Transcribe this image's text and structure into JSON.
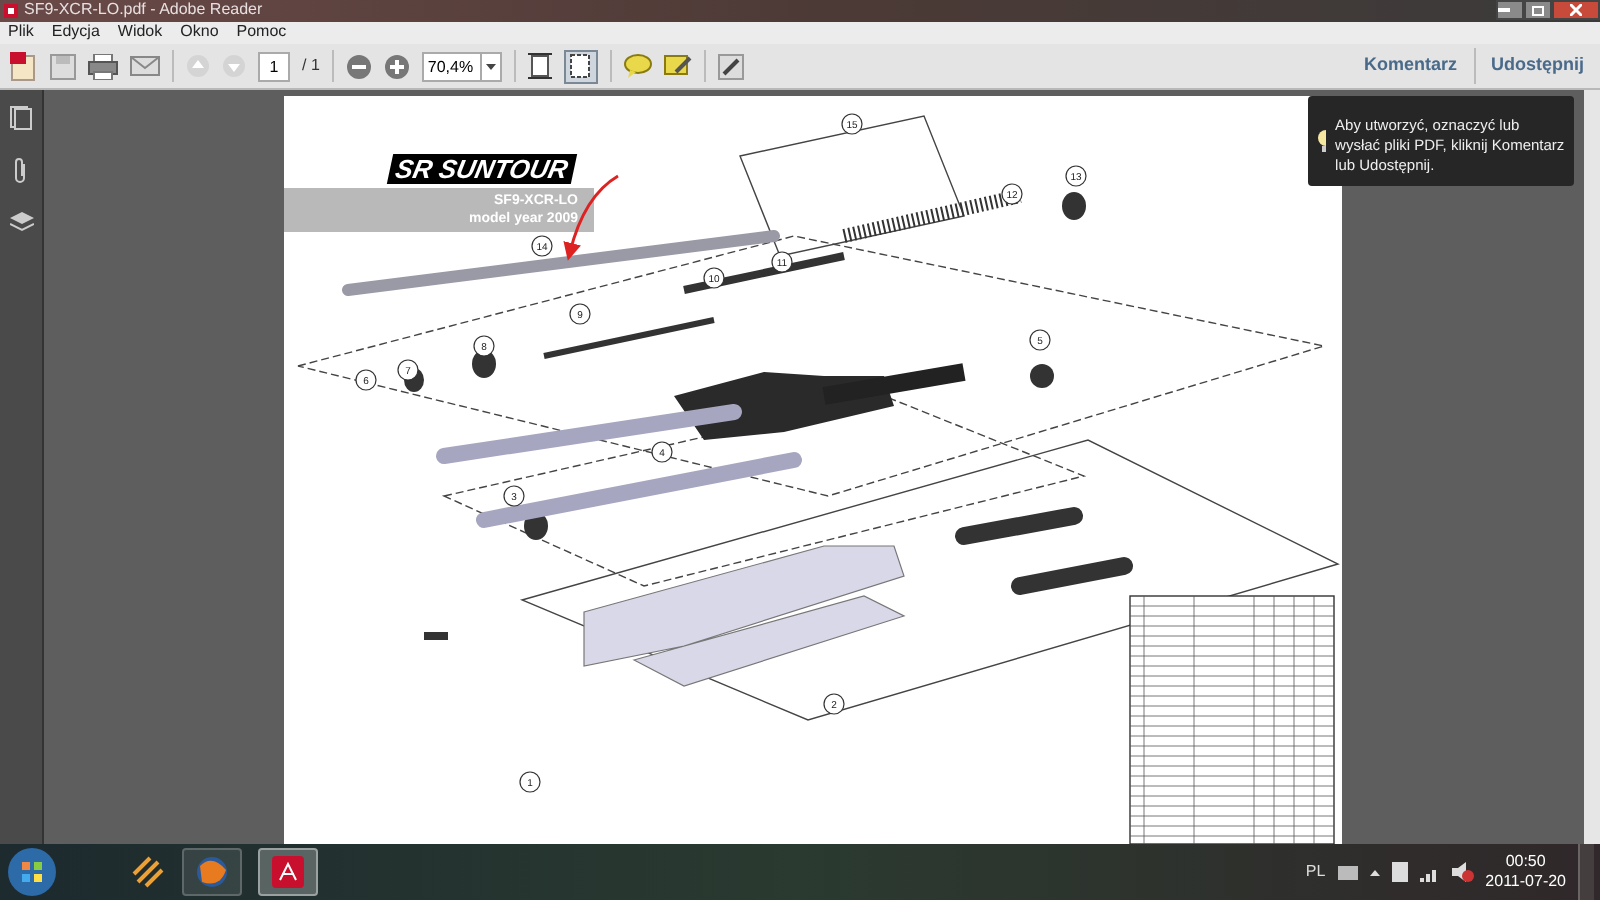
{
  "window": {
    "title": "SF9-XCR-LO.pdf - Adobe Reader"
  },
  "menu": [
    "Plik",
    "Edycja",
    "Widok",
    "Okno",
    "Pomoc"
  ],
  "toolbar": {
    "page": "1",
    "page_total": "/ 1",
    "zoom": "70,4%",
    "links": [
      "Komentarz",
      "Udostępnij"
    ]
  },
  "tip": {
    "text": "Aby utworzyć, oznaczyć lub wysłać pliki PDF, kliknij Komentarz lub Udostępnij."
  },
  "document": {
    "logo": "SR SUNTOUR",
    "model": "SF9-XCR-LO",
    "year": "model year 2009",
    "callouts": [
      "15",
      "12",
      "13",
      "14",
      "11",
      "10",
      "9",
      "8",
      "7",
      "6",
      "5",
      "4",
      "3",
      "2",
      "1"
    ]
  },
  "taskbar": {
    "language": "PL",
    "time": "00:50",
    "date": "2011-07-20"
  }
}
